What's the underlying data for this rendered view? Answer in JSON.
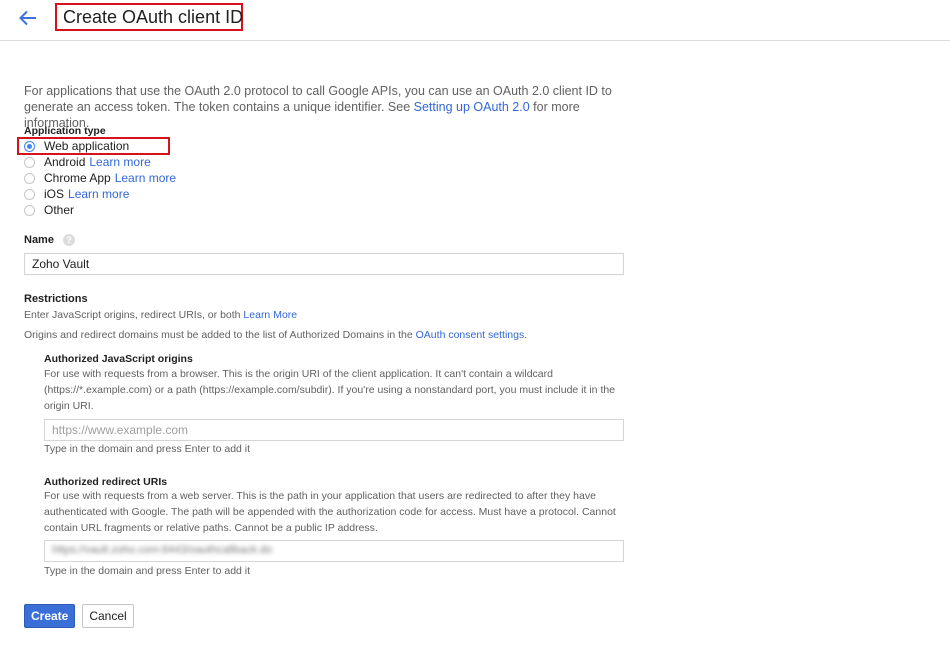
{
  "header": {
    "title": "Create OAuth client ID",
    "back_icon": "arrow-left-icon"
  },
  "intro": {
    "text": "For applications that use the OAuth 2.0 protocol to call Google APIs, you can use an OAuth 2.0 client ID to generate an access token. The token contains a unique identifier. See ",
    "link": "Setting up OAuth 2.0",
    "suffix": " for more information."
  },
  "application_type": {
    "label": "Application type",
    "selected": "Web application",
    "options": [
      {
        "label": "Web application",
        "link": ""
      },
      {
        "label": "Android",
        "link": "Learn more"
      },
      {
        "label": "Chrome App",
        "link": "Learn more"
      },
      {
        "label": "iOS",
        "link": "Learn more"
      },
      {
        "label": "Other",
        "link": ""
      }
    ]
  },
  "name_field": {
    "label": "Name",
    "value": "Zoho Vault"
  },
  "restrictions": {
    "title": "Restrictions",
    "desc_text": "Enter JavaScript origins, redirect URIs, or both ",
    "desc_link": "Learn More",
    "domains_text": "Origins and redirect domains must be added to the list of Authorized Domains in the ",
    "domains_link": "OAuth consent settings",
    "domains_suffix": "."
  },
  "js_origins": {
    "title": "Authorized JavaScript origins",
    "desc": "For use with requests from a browser. This is the origin URI of the client application. It can't contain a wildcard (https://*.example.com) or a path (https://example.com/subdir). If you're using a nonstandard port, you must include it in the origin URI.",
    "placeholder": "https://www.example.com",
    "hint": "Type in the domain and press Enter to add it"
  },
  "redirect_uris": {
    "title": "Authorized redirect URIs",
    "desc": "For use with requests from a web server. This is the path in your application that users are redirected to after they have authenticated with Google. The path will be appended with the authorization code for access. Must have a protocol. Cannot contain URL fragments or relative paths. Cannot be a public IP address.",
    "value": "https://vault.zoho.com:8443/oauthcallback.do",
    "hint": "Type in the domain and press Enter to add it"
  },
  "actions": {
    "create_label": "Create",
    "cancel_label": "Cancel"
  },
  "colors": {
    "accent": "#3367d6",
    "primary_button": "#3b6fd8",
    "highlight_border": "#d6121c"
  }
}
